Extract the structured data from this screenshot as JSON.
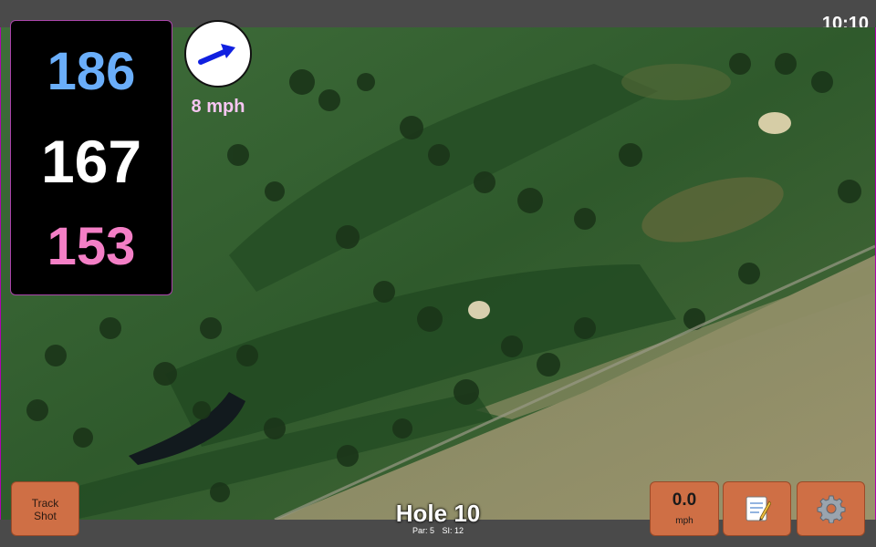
{
  "status_bar": {
    "time": "10:10"
  },
  "distances": {
    "back": "186",
    "middle": "167",
    "front": "153",
    "back_color": "#6aaefa",
    "middle_color": "#ffffff",
    "front_color": "#f47fc6"
  },
  "wind": {
    "speed": "8 mph",
    "arrow_icon": "wind-direction-arrow-icon"
  },
  "track_shot": {
    "label": "Track\nShot"
  },
  "hole": {
    "title": "Hole 10",
    "par": "Par: 5",
    "si": "SI: 12"
  },
  "speed": {
    "value": "0.0",
    "unit": "mph"
  },
  "notes": {
    "icon": "scorecard-note-icon"
  },
  "settings": {
    "icon": "gear-icon"
  },
  "colors": {
    "button": "#cf6f45",
    "chrome": "#4a4a4a",
    "accent": "#b000b0"
  }
}
